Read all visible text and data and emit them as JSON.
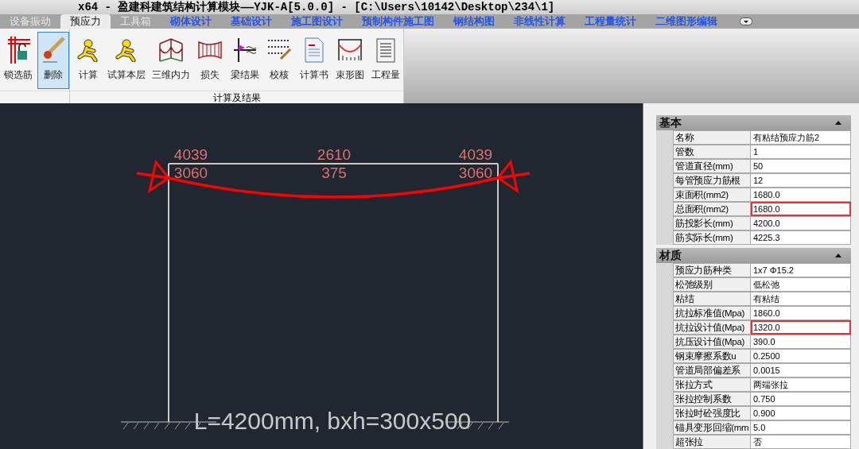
{
  "window": {
    "title": "x64 - 盈建科建筑结构计算模块——YJK-A[5.0.0] - [C:\\Users\\10142\\Desktop\\234\\1]"
  },
  "tabs": [
    {
      "label": "设备振动",
      "selected": false,
      "kind": "plain"
    },
    {
      "label": "预应力",
      "selected": true,
      "kind": "plain"
    },
    {
      "label": "工具箱",
      "selected": false,
      "kind": "plain"
    },
    {
      "label": "砌体设计",
      "selected": false,
      "kind": "module"
    },
    {
      "label": "基础设计",
      "selected": false,
      "kind": "module"
    },
    {
      "label": "施工图设计",
      "selected": false,
      "kind": "module"
    },
    {
      "label": "预制构件施工图",
      "selected": false,
      "kind": "module"
    },
    {
      "label": "钢结构图",
      "selected": false,
      "kind": "module"
    },
    {
      "label": "非线性计算",
      "selected": false,
      "kind": "module"
    },
    {
      "label": "工程量统计",
      "selected": false,
      "kind": "module"
    },
    {
      "label": "二维图形编辑",
      "selected": false,
      "kind": "module"
    }
  ],
  "ribbon": {
    "groups": [
      {
        "buttons": [
          {
            "label": "锁选筋",
            "selected": false
          },
          {
            "label": "删除",
            "selected": true
          }
        ]
      },
      {
        "label": "计算及结果",
        "buttons": [
          {
            "label": "计算",
            "selected": false
          },
          {
            "label": "试算本层",
            "selected": false
          },
          {
            "label": "三维内力",
            "selected": false
          },
          {
            "label": "损失",
            "selected": false
          },
          {
            "label": "梁结果",
            "selected": false
          },
          {
            "label": "校核",
            "selected": false
          },
          {
            "label": "计算书",
            "selected": false
          },
          {
            "label": "束形图",
            "selected": false
          },
          {
            "label": "工程量",
            "selected": false
          }
        ]
      }
    ]
  },
  "drawing": {
    "top_labels": [
      "4039",
      "2610",
      "4039"
    ],
    "bottom_labels": [
      "3060",
      "375",
      "3060"
    ],
    "caption": "L=4200mm, bxh=300x500"
  },
  "properties": [
    {
      "title": "基本",
      "expanded": true,
      "rows": [
        {
          "label": "名称",
          "value": "有粘结预应力筋2",
          "highlighted": false
        },
        {
          "label": "管数",
          "value": "1",
          "highlighted": false
        },
        {
          "label": "管道直径(mm)",
          "value": "50",
          "highlighted": false
        },
        {
          "label": "每管预应力筋根",
          "value": "12",
          "highlighted": false
        },
        {
          "label": "束面积(mm2)",
          "value": "1680.0",
          "highlighted": false
        },
        {
          "label": "总面积(mm2)",
          "value": "1680.0",
          "highlighted": true
        },
        {
          "label": "筋投影长(mm)",
          "value": "4200.0",
          "highlighted": false
        },
        {
          "label": "筋实际长(mm)",
          "value": "4225.3",
          "highlighted": false
        }
      ]
    },
    {
      "title": "材质",
      "expanded": true,
      "rows": [
        {
          "label": "预应力筋种类",
          "value": "1x7 Φ15.2",
          "highlighted": false
        },
        {
          "label": "松弛级别",
          "value": "低松弛",
          "highlighted": false
        },
        {
          "label": "粘结",
          "value": "有粘结",
          "highlighted": false
        },
        {
          "label": "抗拉标准值(Mpa)",
          "value": "1860.0",
          "highlighted": false
        },
        {
          "label": "抗拉设计值(Mpa)",
          "value": "1320.0",
          "highlighted": true
        },
        {
          "label": "抗压设计值(Mpa)",
          "value": "390.0",
          "highlighted": false
        },
        {
          "label": "钢束摩擦系数u",
          "value": "0.2500",
          "highlighted": false
        },
        {
          "label": "管道局部偏差系",
          "value": "0.0015",
          "highlighted": false
        },
        {
          "label": "张拉方式",
          "value": "两端张拉",
          "highlighted": false
        },
        {
          "label": "张拉控制系数",
          "value": "0.750",
          "highlighted": false
        },
        {
          "label": "张拉时砼强度比",
          "value": "0.900",
          "highlighted": false
        },
        {
          "label": "锚具变形回缩(mm",
          "value": "5.0",
          "highlighted": false
        },
        {
          "label": "超张拉",
          "value": "否",
          "highlighted": false
        }
      ]
    }
  ]
}
